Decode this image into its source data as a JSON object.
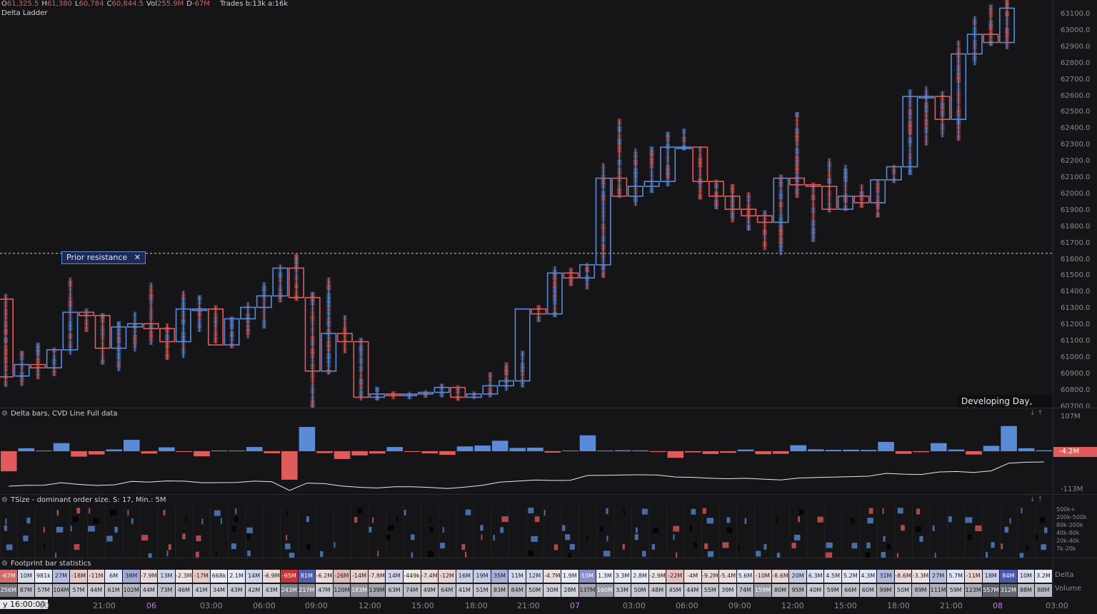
{
  "header": {
    "ohlc": [
      {
        "key": "O",
        "value": "61,325.5"
      },
      {
        "key": "H",
        "value": "61,380"
      },
      {
        "key": "L",
        "value": "60,784"
      },
      {
        "key": "C",
        "value": "60,844.5"
      },
      {
        "key": "Vol",
        "value": "255.9M"
      },
      {
        "key": "D",
        "value": "-67M"
      }
    ],
    "trades": "Trades b:13k a:16k",
    "indicator": "Delta Ladder"
  },
  "price_axis": [
    "63100.0",
    "63000.0",
    "62900.0",
    "62800.0",
    "62700.0",
    "62600.0",
    "62500.0",
    "62400.0",
    "62300.0",
    "62200.0",
    "62100.0",
    "62000.0",
    "61900.0",
    "61800.0",
    "61700.0",
    "61600.0",
    "61500.0",
    "61400.0",
    "61300.0",
    "61200.0",
    "61100.0",
    "61000.0",
    "60900.0",
    "60800.0",
    "60700.0"
  ],
  "annotation": {
    "label": "Prior resistance",
    "close": "✕"
  },
  "developing_label": "Developing Day, Tick *",
  "delta_panel": {
    "title": "Delta bars, CVD Line Full data",
    "axis_top": "107M",
    "axis_bottom": "-113M",
    "current": "-4.2M"
  },
  "tsize_panel": {
    "title": "TSize - dominant order size. S: 17, Min.: 5M",
    "legend": [
      "500k+",
      "200k-500k",
      "80k-200k",
      "40k-80k",
      "20k-40k",
      "7k-20k"
    ]
  },
  "stats_panel": {
    "title": "Footprint bar statistics",
    "delta_label": "Delta",
    "volume_label": "Volume",
    "delta": [
      "-67M",
      "10M",
      "981k",
      "27M",
      "-18M",
      "-11M",
      "6M",
      "38M",
      "-7.9M",
      "13M",
      "-2.3M",
      "-17M",
      "668k",
      "2.1M",
      "14M",
      "-6.9M",
      "-95M",
      "81M",
      "-6.2M",
      "-26M",
      "-14M",
      "-7.8M",
      "14M",
      "-449k",
      "-7.4M",
      "-12M",
      "16M",
      "19M",
      "35M",
      "11M",
      "12M",
      "-4.7M",
      "1.9M",
      "53M",
      "1.3M",
      "3.3M",
      "2.8M",
      "-2.9M",
      "-22M",
      "-4M",
      "-9.2M",
      "-5.4M",
      "5.6M",
      "-10M",
      "-8.6M",
      "20M",
      "6.3M",
      "4.5M",
      "5.2M",
      "4.3M",
      "31M",
      "-8.6M",
      "-3.3M",
      "27M",
      "5.7M",
      "-11M",
      "18M",
      "84M",
      "10M",
      "3.2M"
    ],
    "volume": [
      "256M",
      "87M",
      "57M",
      "104M",
      "57M",
      "44M",
      "61M",
      "102M",
      "44M",
      "73M",
      "46M",
      "41M",
      "34M",
      "43M",
      "42M",
      "43M",
      "243M",
      "217M",
      "47M",
      "120M",
      "183M",
      "139M",
      "63M",
      "74M",
      "49M",
      "64M",
      "41M",
      "51M",
      "83M",
      "84M",
      "50M",
      "30M",
      "28M",
      "137M",
      "160M",
      "53M",
      "50M",
      "48M",
      "45M",
      "44M",
      "55M",
      "39M",
      "74M",
      "159M",
      "80M",
      "95M",
      "40M",
      "59M",
      "66M",
      "60M",
      "99M",
      "50M",
      "89M",
      "111M",
      "59M",
      "123M",
      "557M",
      "312M",
      "88M",
      "88M"
    ]
  },
  "time_axis": [
    {
      "label": "y 16:00:00",
      "cursor": true
    },
    {
      "label": "00"
    },
    {
      "label": "21:00"
    },
    {
      "label": "06",
      "day": true
    },
    {
      "label": "03:00"
    },
    {
      "label": "06:00"
    },
    {
      "label": "09:00"
    },
    {
      "label": "12:00"
    },
    {
      "label": "15:00"
    },
    {
      "label": "18:00"
    },
    {
      "label": "21:00"
    },
    {
      "label": "07",
      "day": true
    },
    {
      "label": "03:00"
    },
    {
      "label": "06:00"
    },
    {
      "label": "09:00"
    },
    {
      "label": "12:00"
    },
    {
      "label": "15:00"
    },
    {
      "label": "18:00"
    },
    {
      "label": "21:00"
    },
    {
      "label": "08",
      "day": true
    },
    {
      "label": "03:00"
    }
  ],
  "colors": {
    "bull": "#5b8bd8",
    "bear": "#e05c5c",
    "bg": "#151517",
    "grid": "#2c2c30",
    "cvd": "#e8e8e8",
    "accent_day": "#c478e0"
  },
  "chart_data": {
    "type": "candlestick",
    "ylim": [
      60700,
      63150
    ],
    "candles": [
      {
        "o": 61320,
        "h": 61350,
        "l": 60784,
        "c": 60845
      },
      {
        "o": 60850,
        "h": 61000,
        "l": 60790,
        "c": 60920
      },
      {
        "o": 60920,
        "h": 61050,
        "l": 60830,
        "c": 60900
      },
      {
        "o": 60900,
        "h": 61020,
        "l": 60850,
        "c": 61010
      },
      {
        "o": 61010,
        "h": 61450,
        "l": 60980,
        "c": 61240
      },
      {
        "o": 61240,
        "h": 61260,
        "l": 61120,
        "c": 61220
      },
      {
        "o": 61220,
        "h": 61230,
        "l": 60920,
        "c": 61020
      },
      {
        "o": 61020,
        "h": 61180,
        "l": 60880,
        "c": 61150
      },
      {
        "o": 61150,
        "h": 61240,
        "l": 61000,
        "c": 61170
      },
      {
        "o": 61170,
        "h": 61420,
        "l": 61040,
        "c": 61140
      },
      {
        "o": 61140,
        "h": 61170,
        "l": 60950,
        "c": 61060
      },
      {
        "o": 61060,
        "h": 61370,
        "l": 60960,
        "c": 61260
      },
      {
        "o": 61260,
        "h": 61340,
        "l": 61120,
        "c": 61260
      },
      {
        "o": 61260,
        "h": 61280,
        "l": 61050,
        "c": 61040
      },
      {
        "o": 61040,
        "h": 61210,
        "l": 61020,
        "c": 61200
      },
      {
        "o": 61200,
        "h": 61300,
        "l": 61080,
        "c": 61270
      },
      {
        "o": 61270,
        "h": 61420,
        "l": 61140,
        "c": 61340
      },
      {
        "o": 61340,
        "h": 61530,
        "l": 61300,
        "c": 61510
      },
      {
        "o": 61510,
        "h": 61590,
        "l": 61310,
        "c": 61330
      },
      {
        "o": 61330,
        "h": 61360,
        "l": 60620,
        "c": 60880
      },
      {
        "o": 60880,
        "h": 61450,
        "l": 60860,
        "c": 61110
      },
      {
        "o": 61110,
        "h": 61220,
        "l": 60990,
        "c": 61060
      },
      {
        "o": 61060,
        "h": 61080,
        "l": 60700,
        "c": 60720
      },
      {
        "o": 60720,
        "h": 60780,
        "l": 60700,
        "c": 60740
      },
      {
        "o": 60740,
        "h": 60750,
        "l": 60710,
        "c": 60730
      },
      {
        "o": 60730,
        "h": 60750,
        "l": 60710,
        "c": 60740
      },
      {
        "o": 60740,
        "h": 60760,
        "l": 60720,
        "c": 60750
      },
      {
        "o": 60750,
        "h": 60800,
        "l": 60720,
        "c": 60780
      },
      {
        "o": 60780,
        "h": 60790,
        "l": 60700,
        "c": 60720
      },
      {
        "o": 60720,
        "h": 60750,
        "l": 60710,
        "c": 60740
      },
      {
        "o": 60740,
        "h": 60870,
        "l": 60720,
        "c": 60790
      },
      {
        "o": 60790,
        "h": 60930,
        "l": 60760,
        "c": 60820
      },
      {
        "o": 60820,
        "h": 61000,
        "l": 60780,
        "c": 61260
      },
      {
        "o": 61260,
        "h": 61280,
        "l": 61180,
        "c": 61230
      },
      {
        "o": 61230,
        "h": 61520,
        "l": 61210,
        "c": 61480
      },
      {
        "o": 61480,
        "h": 61510,
        "l": 61400,
        "c": 61450
      },
      {
        "o": 61450,
        "h": 61540,
        "l": 61380,
        "c": 61530
      },
      {
        "o": 61530,
        "h": 62150,
        "l": 61450,
        "c": 62060
      },
      {
        "o": 62060,
        "h": 62420,
        "l": 61940,
        "c": 61950
      },
      {
        "o": 61950,
        "h": 62240,
        "l": 61890,
        "c": 62010
      },
      {
        "o": 62010,
        "h": 62250,
        "l": 61970,
        "c": 62040
      },
      {
        "o": 62040,
        "h": 62340,
        "l": 62010,
        "c": 62250
      },
      {
        "o": 62250,
        "h": 62360,
        "l": 62230,
        "c": 62250
      },
      {
        "o": 62250,
        "h": 62250,
        "l": 61930,
        "c": 62040
      },
      {
        "o": 62040,
        "h": 62050,
        "l": 61870,
        "c": 61950
      },
      {
        "o": 61950,
        "h": 62020,
        "l": 61790,
        "c": 61870
      },
      {
        "o": 61870,
        "h": 61970,
        "l": 61740,
        "c": 61830
      },
      {
        "o": 61830,
        "h": 61860,
        "l": 61620,
        "c": 61790
      },
      {
        "o": 61790,
        "h": 62080,
        "l": 61590,
        "c": 62060
      },
      {
        "o": 62060,
        "h": 62460,
        "l": 61940,
        "c": 62020
      },
      {
        "o": 62020,
        "h": 62030,
        "l": 61670,
        "c": 62010
      },
      {
        "o": 62010,
        "h": 62180,
        "l": 61850,
        "c": 61870
      },
      {
        "o": 61870,
        "h": 62140,
        "l": 61860,
        "c": 61950
      },
      {
        "o": 61950,
        "h": 62020,
        "l": 61880,
        "c": 61910
      },
      {
        "o": 61910,
        "h": 62050,
        "l": 61820,
        "c": 62050
      },
      {
        "o": 62050,
        "h": 62140,
        "l": 62030,
        "c": 62130
      },
      {
        "o": 62130,
        "h": 62600,
        "l": 62080,
        "c": 62560
      },
      {
        "o": 62560,
        "h": 62620,
        "l": 62260,
        "c": 62560
      },
      {
        "o": 62560,
        "h": 62590,
        "l": 62310,
        "c": 62420
      },
      {
        "o": 62420,
        "h": 62900,
        "l": 62290,
        "c": 62820
      },
      {
        "o": 62820,
        "h": 63050,
        "l": 62750,
        "c": 62940
      },
      {
        "o": 62940,
        "h": 63120,
        "l": 62870,
        "c": 62890
      },
      {
        "o": 62890,
        "h": 63150,
        "l": 62850,
        "c": 63100
      }
    ]
  }
}
